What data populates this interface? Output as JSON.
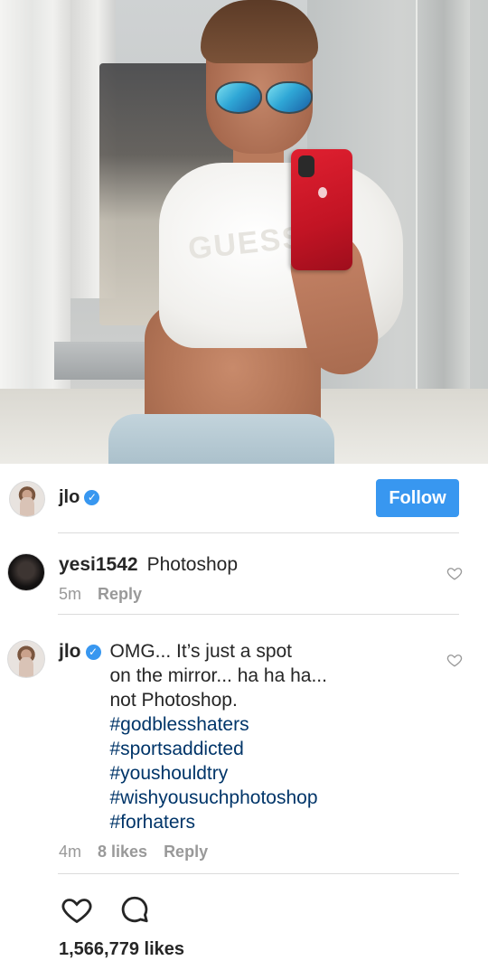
{
  "post": {
    "username": "jlo",
    "verified": true,
    "follow_label": "Follow",
    "likes_count": "1,566,779 likes"
  },
  "photo": {
    "shirt_text": "GUESS"
  },
  "comments": [
    {
      "username": "yesi1542",
      "text": "Photoshop",
      "time": "5m",
      "reply_label": "Reply"
    },
    {
      "username": "jlo",
      "verified": true,
      "text_lines": [
        "OMG... It’s just a spot",
        "on the mirror... ha ha ha...",
        "not Photoshop."
      ],
      "hashtags": [
        "#godblesshaters",
        "#sportsaddicted",
        "#youshouldtry",
        "#wishyousuchphotoshop",
        "#forhaters"
      ],
      "time": "4m",
      "likes": "8 likes",
      "reply_label": "Reply"
    }
  ],
  "colors": {
    "accent": "#3897f0",
    "hashtag": "#003569",
    "muted": "#999999",
    "divider": "#dbdbdb"
  },
  "icons": {
    "verified": "verified-badge-icon",
    "like": "heart-icon",
    "comment": "comment-bubble-icon"
  }
}
